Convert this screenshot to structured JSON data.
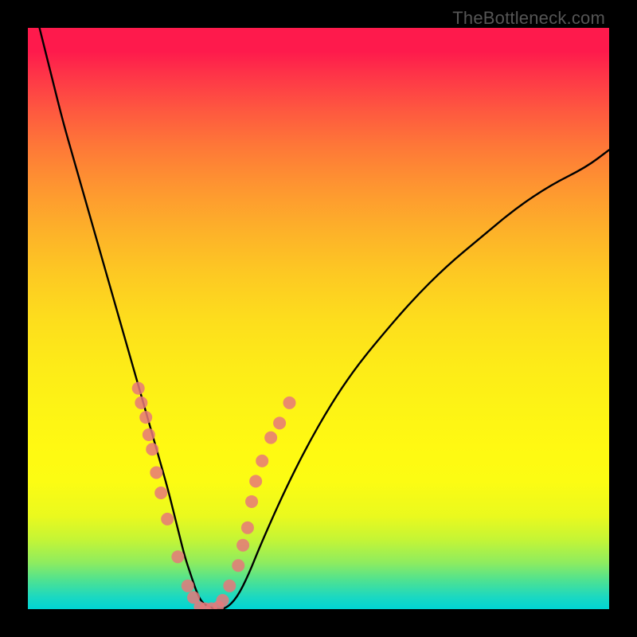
{
  "attribution": "TheBottleneck.com",
  "colors": {
    "frame": "#000000",
    "curve": "#000000",
    "marker": "#e6787a",
    "gradient_stops": [
      "#fe1a4c",
      "#fe3448",
      "#fe5740",
      "#fe7638",
      "#fe9431",
      "#fdae2a",
      "#fdc823",
      "#fddd1d",
      "#fdeb18",
      "#fdf415",
      "#fff912",
      "#fcfc13",
      "#eaf91e",
      "#c5f535",
      "#8eec5f",
      "#4fe291",
      "#1ad8c2",
      "#00d4d4"
    ]
  },
  "chart_data": {
    "type": "line",
    "title": "",
    "xlabel": "",
    "ylabel": "",
    "xlim": [
      0,
      100
    ],
    "ylim": [
      0,
      100
    ],
    "grid": false,
    "curve": {
      "name": "bottleneck-curve",
      "x": [
        2,
        4,
        6,
        8,
        10,
        12,
        14,
        16,
        18,
        20,
        22,
        24,
        25,
        26,
        27,
        28,
        29,
        30,
        32,
        34,
        36,
        38,
        40,
        44,
        48,
        52,
        56,
        60,
        66,
        72,
        78,
        84,
        90,
        96,
        100
      ],
      "y": [
        100,
        92,
        84,
        77,
        70,
        63,
        56,
        49,
        42,
        35,
        28,
        21,
        17,
        13,
        9,
        6,
        3,
        1,
        0,
        0,
        2,
        6,
        11,
        20,
        28,
        35,
        41,
        46,
        53,
        59,
        64,
        69,
        73,
        76,
        79
      ]
    },
    "left_markers": {
      "name": "left-side-points",
      "x": [
        19.0,
        19.5,
        20.3,
        20.8,
        21.4,
        22.1,
        22.9,
        24.0,
        25.8,
        27.5,
        28.5
      ],
      "y": [
        38.0,
        35.5,
        33.0,
        30.0,
        27.5,
        23.5,
        20.0,
        15.5,
        9.0,
        4.0,
        2.0
      ]
    },
    "right_markers": {
      "name": "right-side-points",
      "x": [
        33.5,
        34.7,
        36.2,
        37.0,
        37.8,
        38.5,
        39.2,
        40.3,
        41.8,
        43.3,
        45.0
      ],
      "y": [
        1.5,
        4.0,
        7.5,
        11.0,
        14.0,
        18.5,
        22.0,
        25.5,
        29.5,
        32.0,
        35.5
      ]
    },
    "bottom_markers": {
      "name": "trough-points",
      "x": [
        29.5,
        30.5,
        31.6,
        32.8
      ],
      "y": [
        0.4,
        0.2,
        0.2,
        0.5
      ]
    }
  }
}
